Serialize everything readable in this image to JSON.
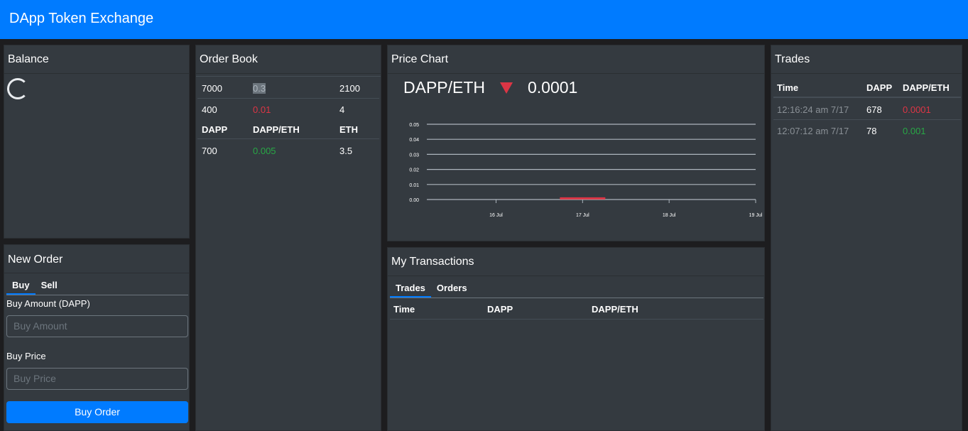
{
  "navbar": {
    "brand": "DApp Token Exchange"
  },
  "balance": {
    "title": "Balance"
  },
  "new_order": {
    "title": "New Order",
    "tabs": [
      "Buy",
      "Sell"
    ],
    "amount_label": "Buy Amount (DAPP)",
    "amount_placeholder": "Buy Amount",
    "price_label": "Buy Price",
    "price_placeholder": "Buy Price",
    "submit_label": "Buy Order"
  },
  "order_book": {
    "title": "Order Book",
    "sell_rows": [
      {
        "dapp": "7000",
        "price": "0.3",
        "eth": "2100"
      },
      {
        "dapp": "400",
        "price": "0.01",
        "eth": "4"
      }
    ],
    "headers": [
      "DAPP",
      "DAPP/ETH",
      "ETH"
    ],
    "buy_rows": [
      {
        "dapp": "700",
        "price": "0.005",
        "eth": "3.5"
      }
    ]
  },
  "price_chart": {
    "title": "Price Chart",
    "pair": "DAPP/ETH",
    "last_price": "0.0001",
    "trend": "down",
    "colors": {
      "down": "#dc3545"
    }
  },
  "chart_data": {
    "type": "candlestick",
    "x": [
      "16 Jul",
      "17 Jul",
      "18 Jul",
      "19 Jul"
    ],
    "y_ticks": [
      "0.05",
      "0.04",
      "0.03",
      "0.02",
      "0.01",
      "0.00"
    ],
    "ylim": [
      0,
      0.05
    ],
    "candles": [
      {
        "date": "17 Jul",
        "open": 0.001,
        "close": 0.0001,
        "high": 0.001,
        "low": 0.0001,
        "color": "#dc3545"
      }
    ],
    "grid": true
  },
  "my_transactions": {
    "title": "My Transactions",
    "tabs": [
      "Trades",
      "Orders"
    ],
    "headers": [
      "Time",
      "DAPP",
      "DAPP/ETH"
    ]
  },
  "trades": {
    "title": "Trades",
    "headers": [
      "Time",
      "DAPP",
      "DAPP/ETH"
    ],
    "rows": [
      {
        "time": "12:16:24 am 7/17",
        "dapp": "678",
        "price": "0.0001",
        "color": "red"
      },
      {
        "time": "12:07:12 am 7/17",
        "dapp": "78",
        "price": "0.001",
        "color": "green"
      }
    ]
  }
}
